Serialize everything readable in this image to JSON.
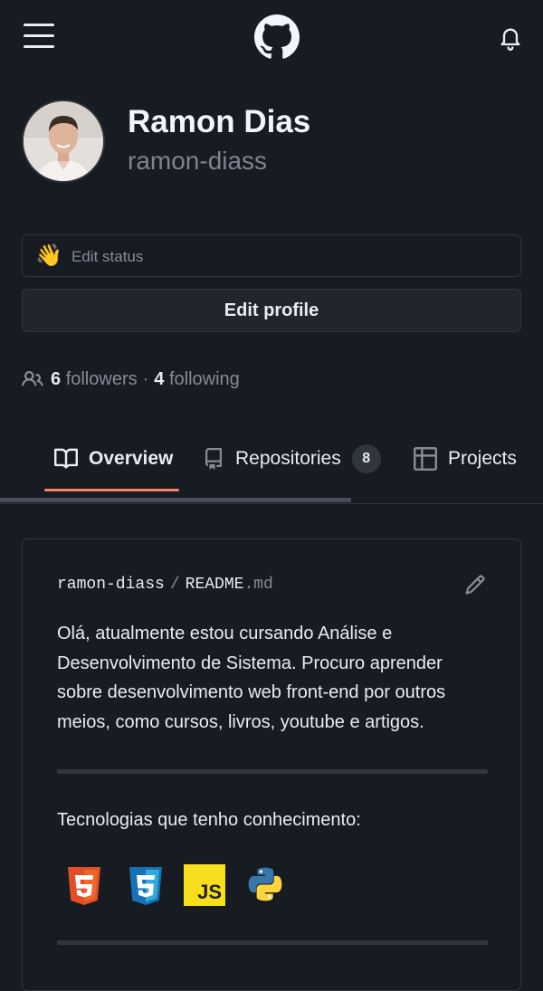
{
  "header": {
    "menu_icon": "hamburger-icon",
    "logo_icon": "github-logo-icon",
    "notifications_icon": "bell-icon"
  },
  "profile": {
    "name": "Ramon Dias",
    "login": "ramon-diass",
    "status_emoji": "👋",
    "status_placeholder": "Edit status",
    "edit_profile_label": "Edit profile",
    "followers_count": "6",
    "followers_label": "followers",
    "separator": "·",
    "following_count": "4",
    "following_label": "following"
  },
  "tabs": [
    {
      "label": "Overview",
      "icon": "book-icon",
      "selected": true
    },
    {
      "label": "Repositories",
      "icon": "repo-icon",
      "counter": "8"
    },
    {
      "label": "Projects",
      "icon": "table-icon"
    }
  ],
  "readme": {
    "owner": "ramon-diass",
    "separator": "/",
    "file_name": "README",
    "file_ext": ".md",
    "edit_icon": "pencil-icon",
    "body": "Olá, atualmente estou cursando Análise e Desenvolvimento de Sistema. Procuro aprender sobre desenvolvimento web front-end por outros meios, como cursos, livros, youtube e artigos.",
    "tech_heading": "Tecnologias que tenho conhecimento:",
    "tech_icons": [
      "html5-icon",
      "css3-icon",
      "javascript-icon",
      "python-icon"
    ],
    "js_badge_text": "JS"
  },
  "colors": {
    "background": "#171b22",
    "border": "#30363d",
    "muted": "#848d97",
    "tab_underline": "#f78166"
  }
}
